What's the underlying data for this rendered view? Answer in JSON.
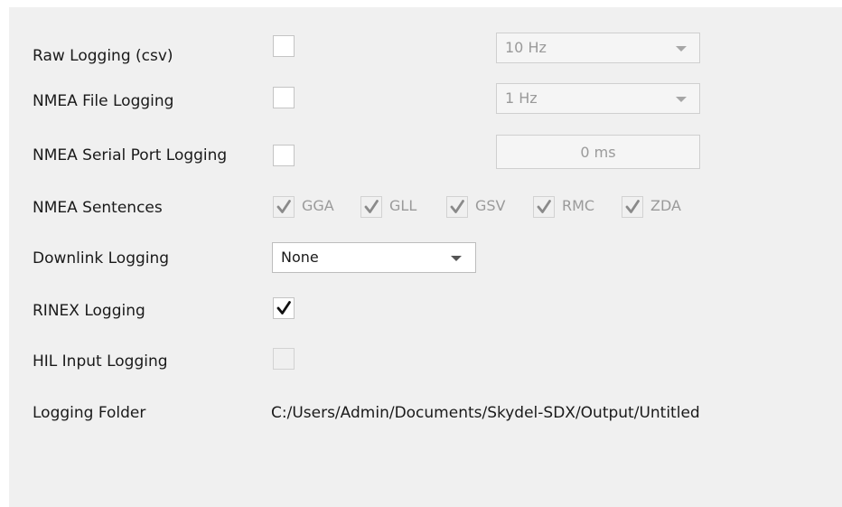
{
  "rows": {
    "raw_logging": {
      "label": "Raw Logging (csv)",
      "checked": false,
      "rate_value": "10 Hz"
    },
    "nmea_file_logging": {
      "label": "NMEA File Logging",
      "checked": false,
      "rate_value": "1 Hz"
    },
    "nmea_serial_port_logging": {
      "label": "NMEA Serial Port Logging",
      "checked": false,
      "delay_value": "0 ms"
    },
    "nmea_sentences": {
      "label": "NMEA Sentences",
      "items": [
        {
          "label": "GGA",
          "checked": true
        },
        {
          "label": "GLL",
          "checked": true
        },
        {
          "label": "GSV",
          "checked": true
        },
        {
          "label": "RMC",
          "checked": true
        },
        {
          "label": "ZDA",
          "checked": true
        }
      ]
    },
    "downlink_logging": {
      "label": "Downlink Logging",
      "selected": "None"
    },
    "rinex_logging": {
      "label": "RINEX Logging",
      "checked": true
    },
    "hil_input_logging": {
      "label": "HIL Input Logging",
      "checked": false
    },
    "logging_folder": {
      "label": "Logging Folder",
      "path": "C:/Users/Admin/Documents/Skydel-SDX/Output/Untitled"
    }
  },
  "icons": {
    "checkmark": "check-icon",
    "dropdown_arrow": "chevron-down-icon"
  },
  "colors": {
    "panel_background": "#f0f0f0",
    "disabled_text": "#9a9a9a",
    "text": "#1a1a1a"
  }
}
